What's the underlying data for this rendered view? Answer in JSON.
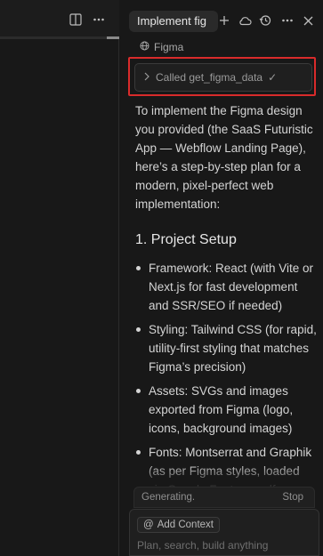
{
  "left": {
    "icons": [
      "split-editor-icon",
      "more-icon"
    ]
  },
  "chat": {
    "tab_title": "Implement fig",
    "header_icons": [
      "add-icon",
      "cloud-icon",
      "history-icon",
      "more-icon",
      "close-icon"
    ],
    "source_label": "Figma",
    "tool_call": {
      "label": "Called get_figma_data",
      "status": "✓"
    },
    "intro": "To implement the Figma design you provided (the SaaS Futuristic App — Webflow Landing Page), here’s a step-by-step plan for a modern, pixel-perfect web implementation:",
    "section_title": "1. Project Setup",
    "bullets": [
      "Framework: React (with Vite or Next.js for fast development and SSR/SEO if needed)",
      "Styling: Tailwind CSS (for rapid, utility-first styling that matches Figma’s precision)",
      "Assets: SVGs and images exported from Figma (logo, icons, background images)",
      "Fonts: Montserrat and Graphik (as per Figma styles, loaded via Google Fonts or self-"
    ]
  },
  "status": {
    "text": "Generating.",
    "stop_label": "Stop"
  },
  "composer": {
    "add_context_label": "Add Context",
    "add_context_symbol": "@",
    "placeholder": "Plan, search, build anything"
  },
  "colors": {
    "background": "#181818",
    "highlight": "#d92b2b",
    "text": "#d4d4d4"
  }
}
